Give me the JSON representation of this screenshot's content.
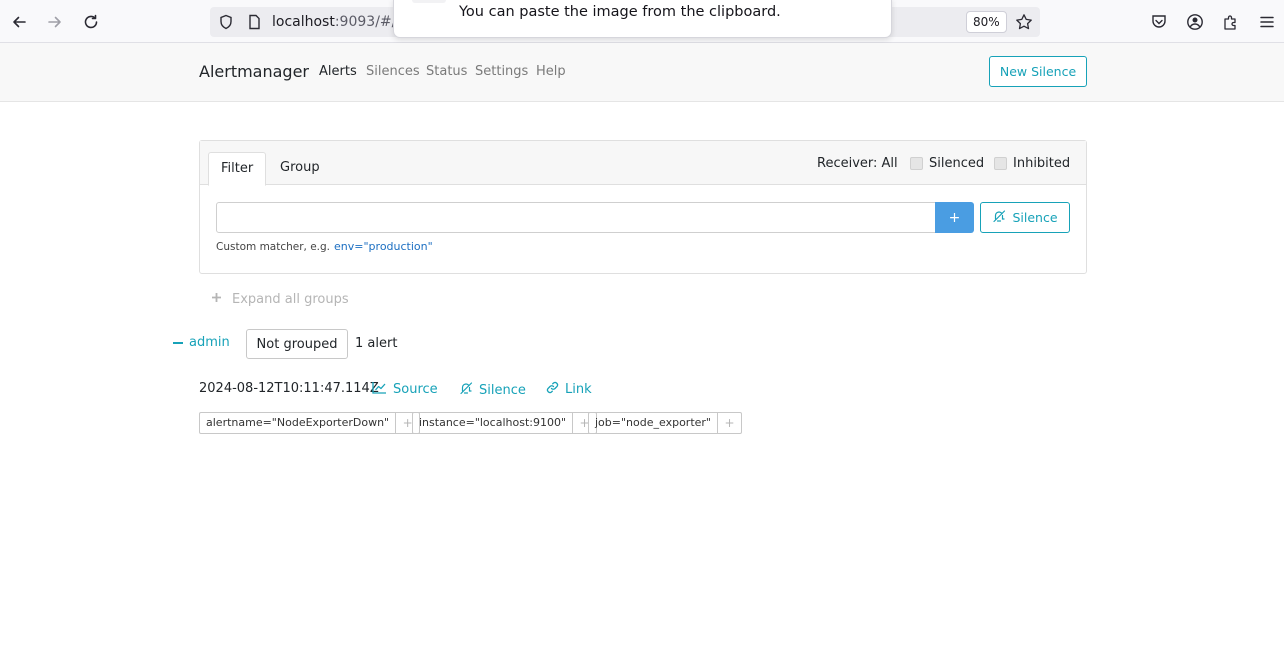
{
  "browser": {
    "url_host": "localhost",
    "url_rest": ":9093/#/",
    "zoom": "80%",
    "toast_text": "You can paste the image from the clipboard."
  },
  "navbar": {
    "brand": "Alertmanager",
    "links": [
      "Alerts",
      "Silences",
      "Status",
      "Settings",
      "Help"
    ],
    "new_silence_label": "New Silence"
  },
  "filter_card": {
    "tabs": [
      "Filter",
      "Group"
    ],
    "receiver_label": "Receiver: All",
    "silenced_label": "Silenced",
    "inhibited_label": "Inhibited",
    "input_value": "",
    "add_label": "+",
    "silence_label": "Silence",
    "hint_text": "Custom matcher, e.g.",
    "hint_example": "env=\"production\""
  },
  "expand_all_label": "Expand all groups",
  "group": {
    "name": "admin",
    "grouping": "Not grouped",
    "count": "1 alert"
  },
  "alert": {
    "timestamp": "2024-08-12T10:11:47.114Z",
    "source_label": "Source",
    "silence_label": "Silence",
    "link_label": "Link",
    "labels": [
      "alertname=\"NodeExporterDown\"",
      "instance=\"localhost:9100\"",
      "job=\"node_exporter\""
    ],
    "label_add": "+"
  },
  "colors": {
    "accent": "#17a2b8",
    "primary_button": "#4a9de2"
  }
}
